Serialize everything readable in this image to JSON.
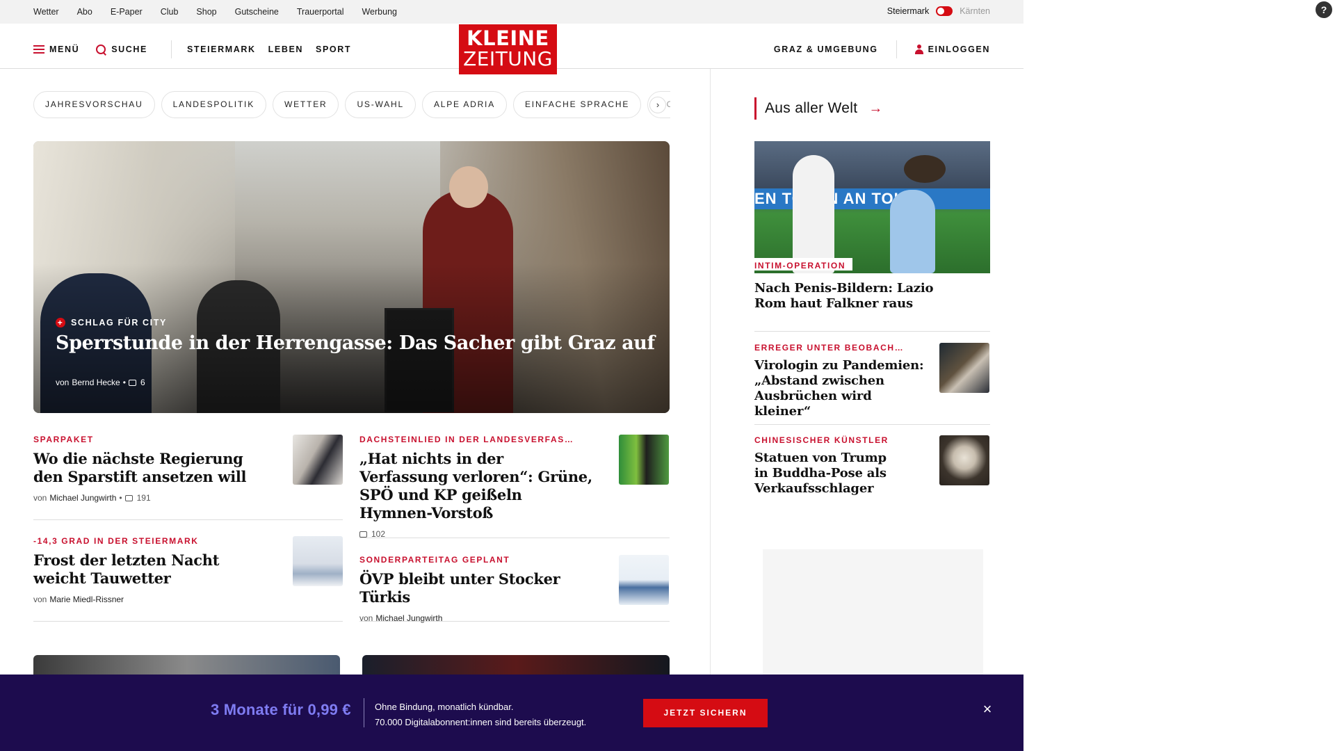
{
  "utility_nav": {
    "links": [
      "Wetter",
      "Abo",
      "E-Paper",
      "Club",
      "Shop",
      "Gutscheine",
      "Trauerportal",
      "Werbung"
    ],
    "region_active": "Steiermark",
    "region_inactive": "Kärnten"
  },
  "header": {
    "menu_label": "MENÜ",
    "search_label": "SUCHE",
    "sections": [
      "STEIERMARK",
      "LEBEN",
      "SPORT"
    ],
    "logo_line1": "KLEINE",
    "logo_line2": "ZEITUNG",
    "local_label": "GRAZ & UMGEBUNG",
    "login_label": "EINLOGGEN"
  },
  "tags": [
    "JAHRESVORSCHAU",
    "LANDESPOLITIK",
    "WETTER",
    "US-WAHL",
    "ALPE ADRIA",
    "EINFACHE SPRACHE",
    "DOS"
  ],
  "tags_next": "›",
  "hero": {
    "kicker": "SCHLAG FÜR CITY",
    "title": "Sperrstunde in der Herrengasse: Das Sacher gibt Graz auf",
    "by": "von",
    "author": "Bernd Hecke",
    "separator": "•",
    "comments": "6"
  },
  "teasers": [
    {
      "kicker": "SPARPAKET",
      "title": "Wo die nächste Regierung den Sparstift ansetzen will",
      "by": "von",
      "author": "Michael Jungwirth",
      "separator": "•",
      "comments": "191"
    },
    {
      "kicker": "DACHSTEINLIED IN DER LANDESVERFAS…",
      "title": "„Hat nichts in der Verfassung verloren“: Grüne, SPÖ und KP geißeln Hymnen-Vorstoß",
      "by": "",
      "author": "",
      "separator": "",
      "comments": "102"
    },
    {
      "kicker": "-14,3 GRAD IN DER STEIERMARK",
      "title": "Frost der letzten Nacht weicht Tauwetter",
      "by": "von",
      "author": "Marie Miedl-Rissner",
      "separator": "",
      "comments": ""
    },
    {
      "kicker": "SONDERPARTEITAG GEPLANT",
      "title": "ÖVP bleibt unter Stocker Türkis",
      "by": "von",
      "author": "Michael Jungwirth",
      "separator": "",
      "comments": ""
    }
  ],
  "sidebar": {
    "heading": "Aus aller Welt",
    "heading_arrow": "→",
    "lead": {
      "banner_text": "EN   TOKEN   AN TOK",
      "kicker": "INTIM-OPERATION",
      "title": "Nach Penis-Bildern: Lazio Rom haut Falkner raus"
    },
    "items": [
      {
        "kicker": "ERREGER UNTER BEOBACH…",
        "title": "Virologin zu Pandemien: „Abstand zwischen Ausbrüchen wird kleiner“"
      },
      {
        "kicker": "CHINESISCHER KÜNSTLER",
        "title": "Statuen von Trump in Buddha-Pose als Verkaufsschlager"
      }
    ]
  },
  "promo": {
    "price": "3 Monate für 0,99 €",
    "line1": "Ohne Bindung, monatlich kündbar.",
    "line2": "70.000 Digitalabonnent:innen sind bereits überzeugt.",
    "cta": "JETZT SICHERN",
    "close": "×"
  },
  "help_icon": "?",
  "colors": {
    "brand_red": "#d50c13",
    "promo_bg": "#1d0c4e",
    "promo_price": "#7f7cf2"
  },
  "icons": [
    "hamburger-icon",
    "search-icon",
    "user-icon",
    "comment-icon",
    "plus-icon",
    "chevron-right-icon",
    "arrow-right-icon",
    "close-icon",
    "help-icon"
  ]
}
